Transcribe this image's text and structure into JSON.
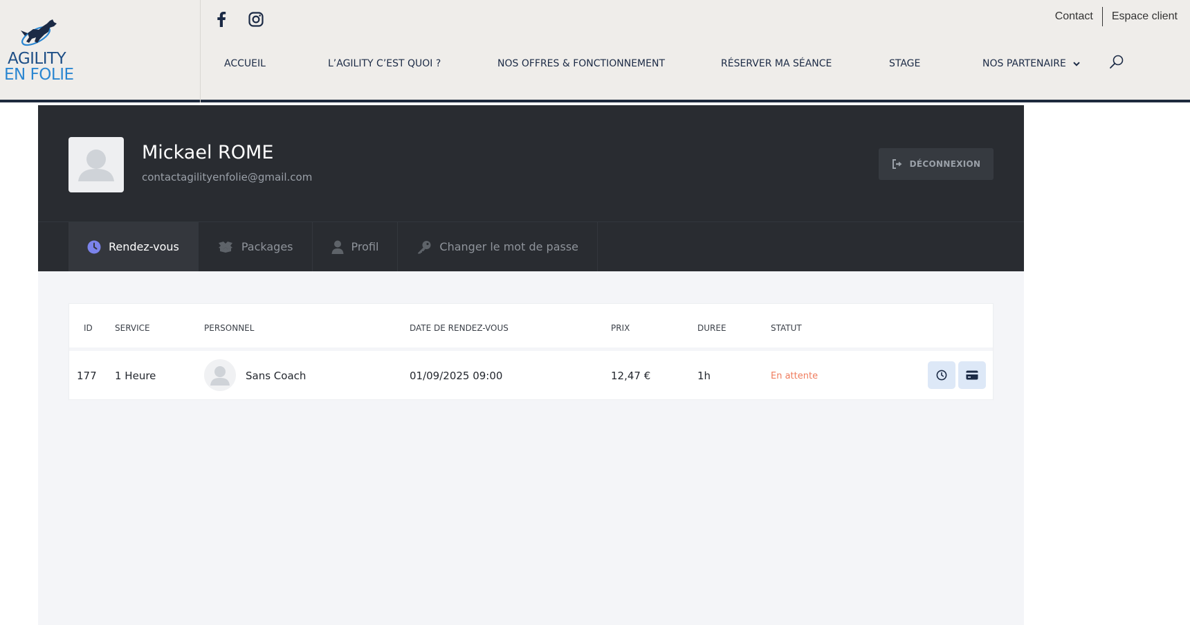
{
  "header": {
    "logo": {
      "line1": "AGILITY",
      "line2": "EN FOLIE"
    },
    "social": [
      "facebook-icon",
      "instagram-icon"
    ],
    "top_links": {
      "contact": "Contact",
      "client_area": "Espace client"
    },
    "nav": {
      "home": "ACCUEIL",
      "what_is": "L’AGILITY C’EST QUOI ?",
      "offers": "NOS OFFRES & FONCTIONNEMENT",
      "book": "RÉSERVER MA SÉANCE",
      "stage": "STAGE",
      "partners": "NOS PARTENAIRE"
    }
  },
  "profile": {
    "name": "Mickael ROME",
    "email": "contactagilityenfolie@gmail.com",
    "logout_label": "DÉCONNEXION"
  },
  "tabs": {
    "appointments": "Rendez-vous",
    "packages": "Packages",
    "profile": "Profil",
    "change_password": "Changer le mot de passe"
  },
  "table": {
    "headers": {
      "id": "ID",
      "service": "SERVICE",
      "staff": "PERSONNEL",
      "date": "DATE DE RENDEZ-VOUS",
      "price": "PRIX",
      "duration": "DUREE",
      "status": "STATUT"
    },
    "rows": [
      {
        "id": "177",
        "service": "1 Heure",
        "staff": "Sans Coach",
        "date": "01/09/2025 09:00",
        "price": "12,47 €",
        "duration": "1h",
        "status": "En attente"
      }
    ]
  },
  "colors": {
    "accent_active_tab_icon": "#7b83eb",
    "status_pending": "#ef7b5c",
    "panel_dark": "#292c31",
    "header_bg": "#efedea",
    "header_border": "#1e2a3d"
  }
}
